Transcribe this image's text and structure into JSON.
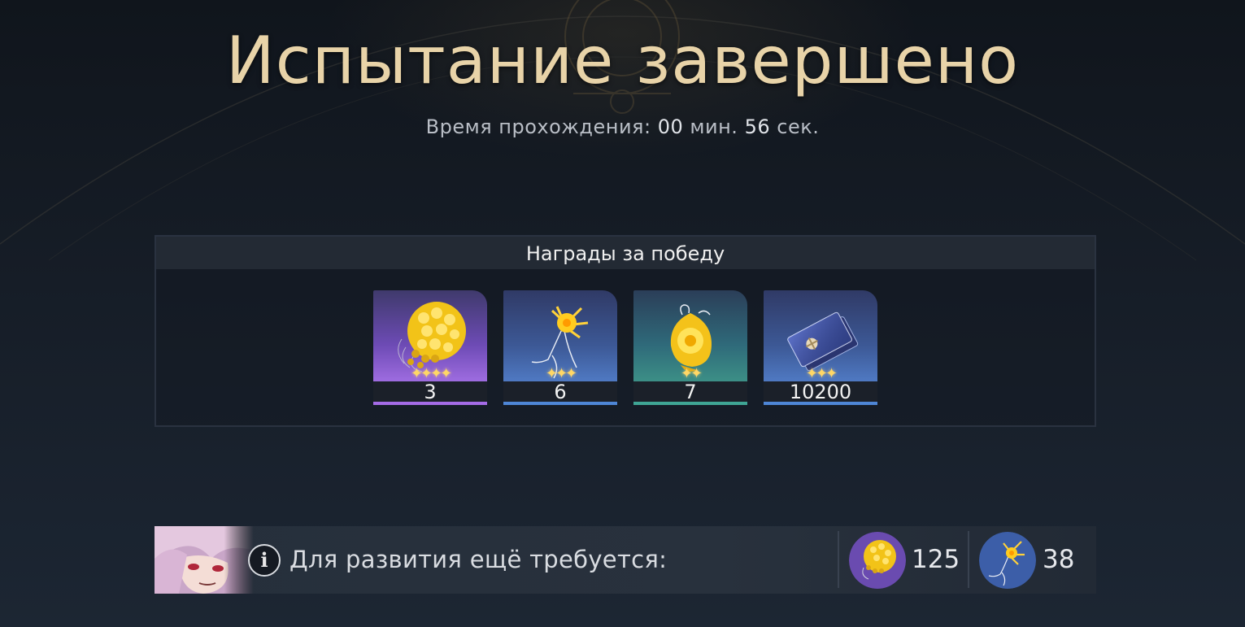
{
  "title": "Испытание завершено",
  "completion_time": {
    "prefix": "Время прохождения:",
    "minutes": "00",
    "minutes_unit": "мин.",
    "seconds": "56",
    "seconds_unit": "сек."
  },
  "rewards": {
    "header": "Награды за победу",
    "items": [
      {
        "icon": "golden-cluster-material-icon",
        "rarity": 4,
        "stars": "✦✦✦✦",
        "count": "3",
        "color": "purple",
        "bar_color": "#a46be6"
      },
      {
        "icon": "golden-neuron-material-icon",
        "rarity": 3,
        "stars": "✦✦✦",
        "count": "6",
        "color": "blue",
        "bar_color": "#4e86d6"
      },
      {
        "icon": "golden-drop-material-icon",
        "rarity": 2,
        "stars": "✦✦",
        "count": "7",
        "color": "teal",
        "bar_color": "#3fa595"
      },
      {
        "icon": "credit-card-currency-icon",
        "rarity": 3,
        "stars": "✦✦✦",
        "count": "10200",
        "color": "blue2",
        "bar_color": "#4e86d6"
      }
    ]
  },
  "development": {
    "label": "Для развития ещё требуется:",
    "info_symbol": "i",
    "requirements": [
      {
        "icon": "golden-cluster-material-icon",
        "count": "125"
      },
      {
        "icon": "golden-neuron-material-icon",
        "count": "38"
      }
    ]
  },
  "colors": {
    "title": "#e8d3a8",
    "background": "#141a23",
    "panel_header": "#232a34"
  }
}
